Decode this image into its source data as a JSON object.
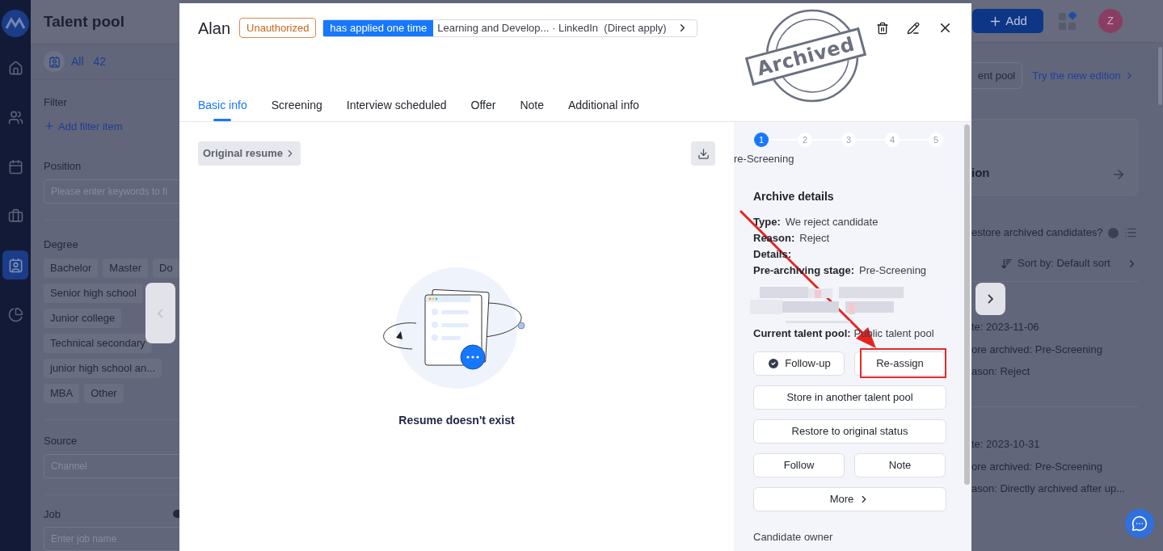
{
  "nav": {
    "items": [
      {
        "kind": "home",
        "selected": false
      },
      {
        "kind": "people",
        "selected": false
      },
      {
        "kind": "calendar",
        "selected": false
      },
      {
        "kind": "briefcase",
        "selected": false
      },
      {
        "kind": "talent",
        "selected": true
      },
      {
        "kind": "chart",
        "selected": false
      }
    ]
  },
  "sidebar": {
    "title": "Talent pool",
    "all_label": "All",
    "all_count": "42",
    "filter_label": "Filter",
    "add_filter": "Add filter item",
    "position": {
      "label": "Position",
      "placeholder": "Please enter keywords to fi"
    },
    "degree": {
      "label": "Degree",
      "options": [
        "Bachelor",
        "Master",
        "Do",
        "Senior high school",
        "Junior college",
        "Technical secondary",
        "junior high school an...",
        "MBA",
        "Other"
      ]
    },
    "source": {
      "label": "Source",
      "placeholder": "Channel"
    },
    "job": {
      "label": "Job",
      "placeholder": "Enter job name"
    }
  },
  "topbar": {
    "add_button": "Add",
    "avatar": "Z"
  },
  "background": {
    "pool_button": "ent pool",
    "new_edition": "Try the new edition",
    "card_title": "ion",
    "restore_question": "estore archived candidates?",
    "sort": "Sort by: Default sort",
    "records": [
      {
        "lines": [
          "te: 2023-11-06",
          "ore archived: Pre-Screening",
          "ason: Reject"
        ]
      },
      {
        "lines": [
          "te: 2023-10-31",
          "ore archived: Pre-Screening",
          "ason: Directly archived after up..."
        ]
      }
    ]
  },
  "modal": {
    "name": "Alan",
    "auth_badge": "Unauthorized",
    "applied_count": "has applied one time",
    "applied_detail": "Learning and Develop... · LinkedIn  (Direct apply)",
    "stamp": "Archived",
    "tabs": [
      {
        "label": "Basic info",
        "selected": true
      },
      {
        "label": "Screening",
        "selected": false
      },
      {
        "label": "Interview scheduled",
        "selected": false
      },
      {
        "label": "Offer",
        "selected": false
      },
      {
        "label": "Note",
        "selected": false
      },
      {
        "label": "Additional info",
        "selected": false
      }
    ],
    "resume_button": "Original resume",
    "empty_text": "Resume doesn't exist",
    "steps": [
      {
        "label": "1",
        "selected": true
      },
      {
        "label": "2",
        "selected": false
      },
      {
        "label": "3",
        "selected": false
      },
      {
        "label": "4",
        "selected": false
      },
      {
        "label": "5",
        "selected": false
      }
    ],
    "stage_label": "re-Screening",
    "archive_title": "Archive details",
    "fields": [
      {
        "label": "Type:",
        "value": "We reject candidate"
      },
      {
        "label": "Reason:",
        "value": "Reject"
      },
      {
        "label": "Details:"
      },
      {
        "label": "Pre-archiving stage:",
        "value": "Pre-Screening"
      }
    ],
    "current_pool": {
      "label": "Current talent pool:",
      "value": "Public talent pool"
    },
    "actions": [
      {
        "label": "Follow-up",
        "kind": "check",
        "highlighted": false
      },
      {
        "label": "Re-assign",
        "kind": "half",
        "highlighted": true
      },
      {
        "label": "Store in another talent pool",
        "kind": "full",
        "highlighted": false
      },
      {
        "label": "Restore to original status",
        "kind": "full",
        "highlighted": false
      },
      {
        "label": "Follow",
        "kind": "half",
        "highlighted": false
      },
      {
        "label": "Note",
        "kind": "half",
        "highlighted": false
      },
      {
        "label": "More",
        "kind": "more",
        "highlighted": false
      }
    ],
    "owner_label": "Candidate owner"
  }
}
